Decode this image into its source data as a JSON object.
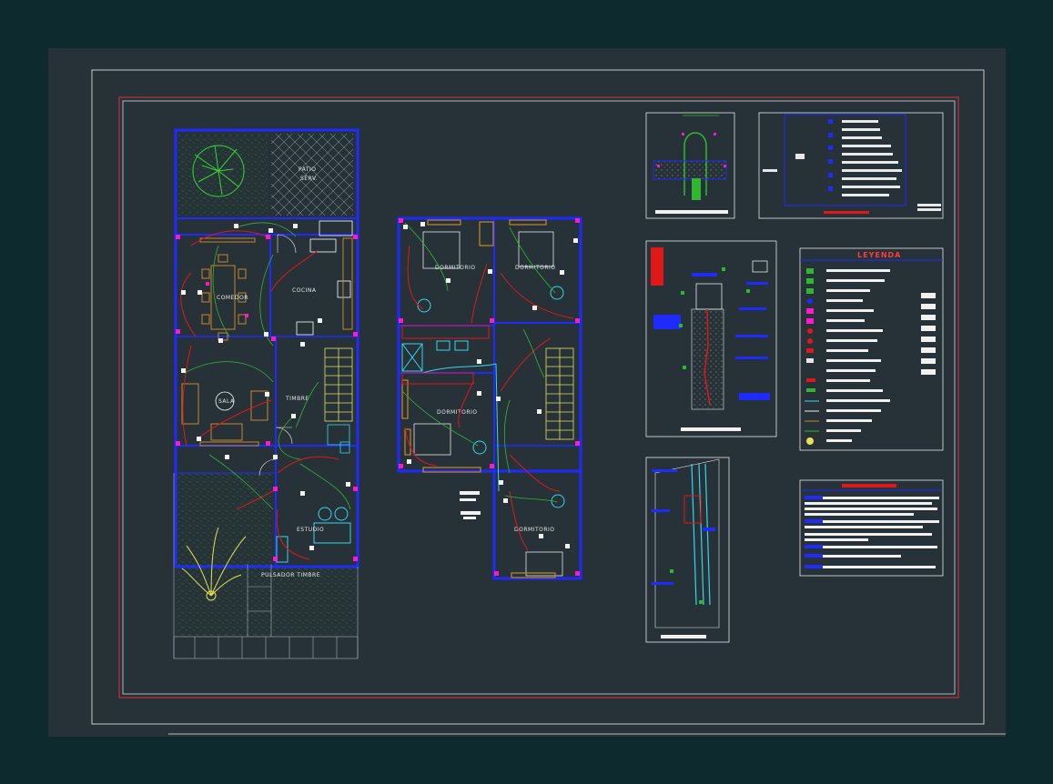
{
  "rooms": {
    "patio": "PATIO",
    "patio2": "SERV.",
    "comedor": "COMEDOR",
    "cocina": "COCINA",
    "sala": "SALA",
    "timbre": "TIMBRE",
    "estudio": "ESTUDIO",
    "pulsador": "PULSADOR TIMBRE",
    "dormitorio1": "DORMITORIO",
    "dormitorio2": "DORMITORIO",
    "dormitorio3": "DORMITORIO",
    "dormitorio4": "DORMITORIO"
  },
  "legend": {
    "title": "LEYENDA"
  },
  "colors": {
    "background": "#0d2a2f",
    "sheet": "#263238",
    "walls": "#1d2bff",
    "circuit_red": "#e01818",
    "circuit_green": "#2fb82f",
    "device_magenta": "#ff19c8",
    "cyan": "#35d7e8",
    "furniture_orange": "#c8872a",
    "stairs_yellow": "#e8e05a"
  }
}
